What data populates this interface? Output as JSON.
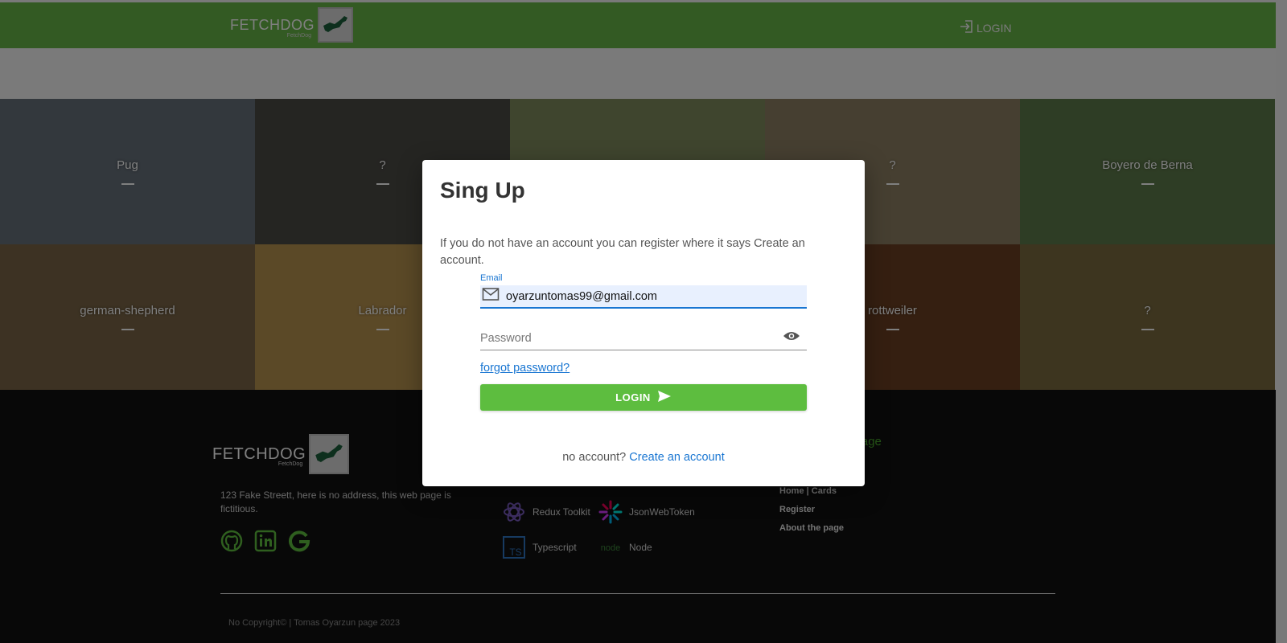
{
  "header": {
    "logo_text": "FETCHDOG",
    "logo_sub": "FetchDog",
    "login_label": "LOGIN"
  },
  "colors": {
    "header_green": "#66b447",
    "accent_blue": "#1976d2",
    "button_green": "#5dbd3f",
    "footer_bg": "#111111"
  },
  "tiles": [
    {
      "name": "Pug",
      "bg": "#66707a"
    },
    {
      "name": "?",
      "bg": "#4b4a45"
    },
    {
      "name": "",
      "bg": "#7f8a5c"
    },
    {
      "name": "?",
      "bg": "#8d7f62"
    },
    {
      "name": "Boyero de Berna",
      "bg": "#5d7a4a"
    },
    {
      "name": "german-shepherd",
      "bg": "#7a6546"
    },
    {
      "name": "Labrador",
      "bg": "#b7924f"
    },
    {
      "name": "",
      "bg": "#6a5a3a"
    },
    {
      "name": "rottweiler",
      "bg": "#6b3f22"
    },
    {
      "name": "?",
      "bg": "#7a6b3f"
    }
  ],
  "modal": {
    "title": "Sing Up",
    "description": "If you do not have an account you can register where it says Create an account.",
    "email_label": "Email",
    "email_value": "oyarzuntomas99@gmail.com",
    "password_placeholder": "Password",
    "forgot_label": "forgot password?",
    "login_label": "LOGIN",
    "no_account_text": "no account?",
    "create_account_label": "Create an account"
  },
  "footer": {
    "logo_text": "FETCHDOG",
    "logo_sub": "FetchDog",
    "address": "123 Fake Streett, here is no address, this web page is fictitious.",
    "socials": [
      "github-icon",
      "linkedin-icon",
      "google-icon"
    ],
    "tech": [
      {
        "label": "Redux Toolkit",
        "icon": "redux-icon"
      },
      {
        "label": "JsonWebToken",
        "icon": "jwt-icon"
      },
      {
        "label": "Typescript",
        "icon": "typescript-icon"
      },
      {
        "label": "Node",
        "icon": "node-icon"
      }
    ],
    "section_title_partial": "e page",
    "links": [
      "Home | Cards",
      "Register",
      "About the page"
    ],
    "copyright": "No Copyright© | Tomas Oyarzun page 2023"
  }
}
